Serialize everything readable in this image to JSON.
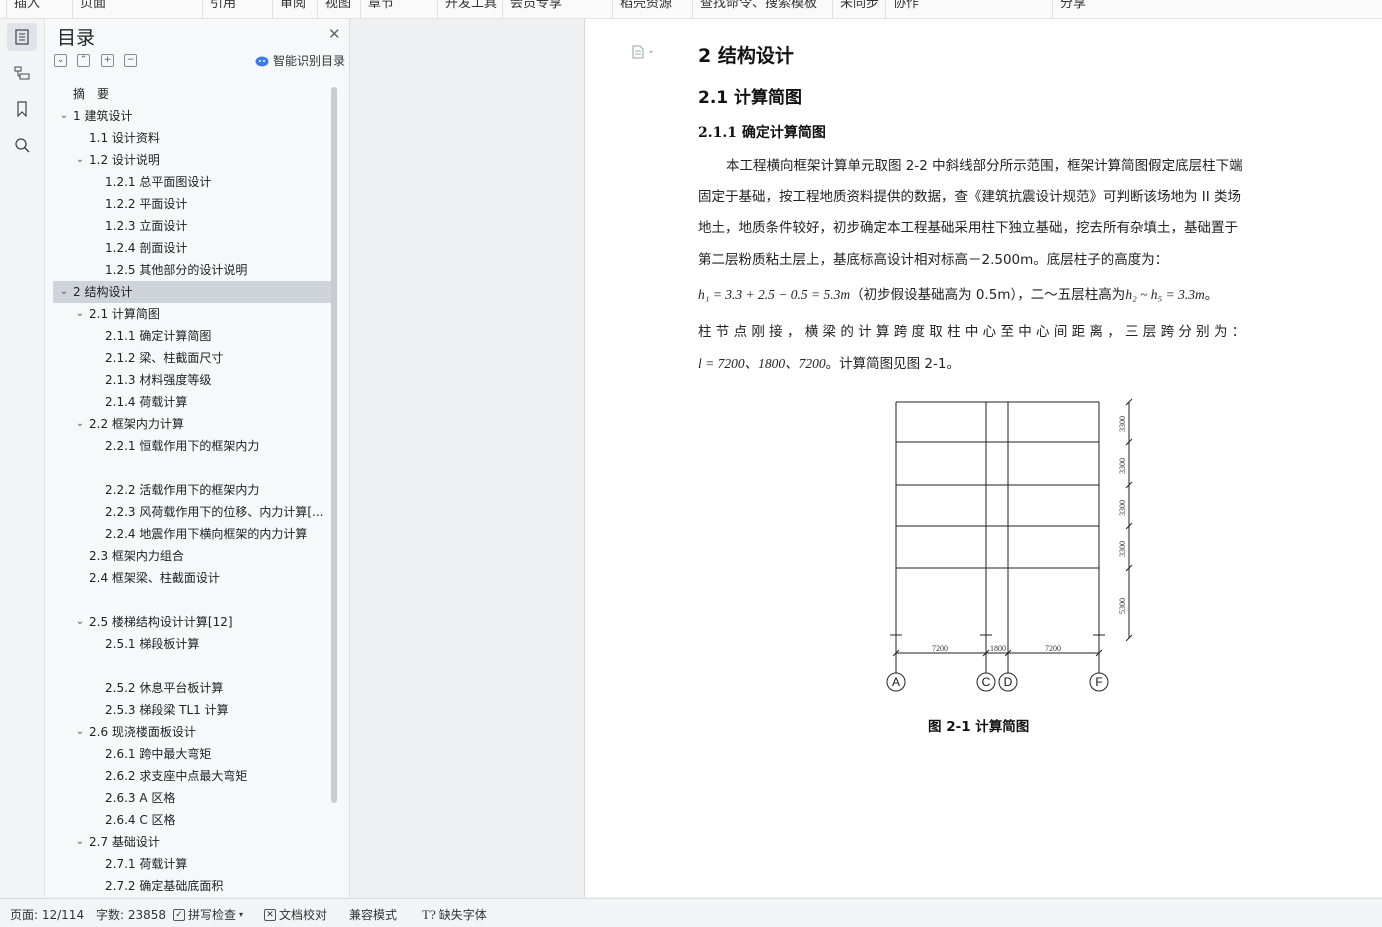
{
  "toolbar": {
    "items": [
      "插入",
      "页面",
      "引用",
      "审阅",
      "视图",
      "章节",
      "开发工具",
      "会员专享",
      "稻壳资源",
      "查找命令、搜索模板",
      "未同步",
      "协作",
      "分享"
    ]
  },
  "toc_panel": {
    "title": "目录",
    "smart_label": "智能识别目录",
    "items": [
      {
        "label": "摘　要",
        "level": 0,
        "arrow": ""
      },
      {
        "label": "1  建筑设计",
        "level": 0,
        "arrow": "v"
      },
      {
        "label": "1.1  设计资料",
        "level": 1,
        "arrow": ""
      },
      {
        "label": "1.2 设计说明",
        "level": 1,
        "arrow": "v"
      },
      {
        "label": "1.2.1 总平面图设计",
        "level": 2,
        "arrow": ""
      },
      {
        "label": "1.2.2  平面设计",
        "level": 2,
        "arrow": ""
      },
      {
        "label": "1.2.3  立面设计",
        "level": 2,
        "arrow": ""
      },
      {
        "label": "1.2.4  剖面设计",
        "level": 2,
        "arrow": ""
      },
      {
        "label": "1.2.5  其他部分的设计说明",
        "level": 2,
        "arrow": ""
      },
      {
        "label": "2  结构设计",
        "level": 0,
        "arrow": "v",
        "selected": true
      },
      {
        "label": "2.1 计算简图",
        "level": 1,
        "arrow": "v"
      },
      {
        "label": "2.1.1 确定计算简图",
        "level": 2,
        "arrow": ""
      },
      {
        "label": "2.1.2 梁、柱截面尺寸",
        "level": 2,
        "arrow": ""
      },
      {
        "label": "2.1.3 材料强度等级",
        "level": 2,
        "arrow": ""
      },
      {
        "label": "2.1.4 荷载计算",
        "level": 2,
        "arrow": ""
      },
      {
        "label": "2.2 框架内力计算",
        "level": 1,
        "arrow": "v"
      },
      {
        "label": "2.2.1 恒载作用下的框架内力",
        "level": 2,
        "arrow": ""
      },
      {
        "label": "",
        "level": 2,
        "arrow": ""
      },
      {
        "label": "2.2.2 活载作用下的框架内力",
        "level": 2,
        "arrow": ""
      },
      {
        "label": "2.2.3 风荷载作用下的位移、内力计算[...",
        "level": 2,
        "arrow": ""
      },
      {
        "label": "2.2.4 地震作用下横向框架的内力计算",
        "level": 2,
        "arrow": ""
      },
      {
        "label": "2.3 框架内力组合",
        "level": 1,
        "arrow": ""
      },
      {
        "label": "2.4 框架梁、柱截面设计",
        "level": 1,
        "arrow": ""
      },
      {
        "label": "",
        "level": 1,
        "arrow": ""
      },
      {
        "label": "2.5 楼梯结构设计计算[12]",
        "level": 1,
        "arrow": "v"
      },
      {
        "label": "2.5.1 梯段板计算",
        "level": 2,
        "arrow": ""
      },
      {
        "label": "",
        "level": 2,
        "arrow": ""
      },
      {
        "label": "2.5.2 休息平台板计算",
        "level": 2,
        "arrow": ""
      },
      {
        "label": "2.5.3 梯段梁 TL1 计算",
        "level": 2,
        "arrow": ""
      },
      {
        "label": "2.6 现浇楼面板设计",
        "level": 1,
        "arrow": "v"
      },
      {
        "label": "2.6.1 跨中最大弯矩",
        "level": 2,
        "arrow": ""
      },
      {
        "label": "2.6.2 求支座中点最大弯矩",
        "level": 2,
        "arrow": ""
      },
      {
        "label": "2.6.3 A 区格",
        "level": 2,
        "arrow": ""
      },
      {
        "label": "2.6.4 C 区格",
        "level": 2,
        "arrow": ""
      },
      {
        "label": "2.7 基础设计",
        "level": 1,
        "arrow": "v"
      },
      {
        "label": "2.7.1 荷载计算",
        "level": 2,
        "arrow": ""
      },
      {
        "label": "2.7.2 确定基础底面积",
        "level": 2,
        "arrow": ""
      }
    ]
  },
  "document": {
    "h1": "2  结构设计",
    "h2": "2.1 计算简图",
    "h3": "2.1.1 确定计算简图",
    "para1": "本工程横向框架计算单元取图 2-2 中斜线部分所示范围，框架计算简图假定底层柱下端",
    "para2": "固定于基础，按工程地质资料提供的数据，查《建筑抗震设计规范》可判断该场地为 II 类场",
    "para3": "地土，地质条件较好，初步确定本工程基础采用柱下独立基础，挖去所有杂填土，基础置于",
    "para4": "第二层粉质粘土层上，基底标高设计相对标高－2.500m。底层柱子的高度为：",
    "para5_math": "h₁ = 3.3 + 2.5 − 0.5 = 5.3m",
    "para5_text": "（初步假设基础高为 0.5m），二～五层柱高为",
    "para5_math2": "h₂ ~ h₅ = 3.3m",
    "para5_end": "。",
    "para6": "柱 节 点 刚 接 ， 横 梁 的 计 算 跨 度 取 柱 中 心 至 中 心 间 距 离 ， 三 层 跨 分 别 为 ：",
    "para7_math": "l = 7200、1800、7200",
    "para7_text": "。计算简图见图 2-1。",
    "figure": {
      "spans": [
        "7200",
        "1800",
        "7200"
      ],
      "heights": [
        "3300",
        "3300",
        "3300",
        "3300",
        "5300"
      ],
      "axes": [
        "A",
        "C",
        "D",
        "F"
      ],
      "caption": "图 2-1   计算简图"
    }
  },
  "statusbar": {
    "page": "页面: 12/114",
    "words": "字数: 23858",
    "spell": "拼写检查",
    "proof": "文档校对",
    "compat": "兼容模式",
    "font_missing": "缺失字体"
  }
}
